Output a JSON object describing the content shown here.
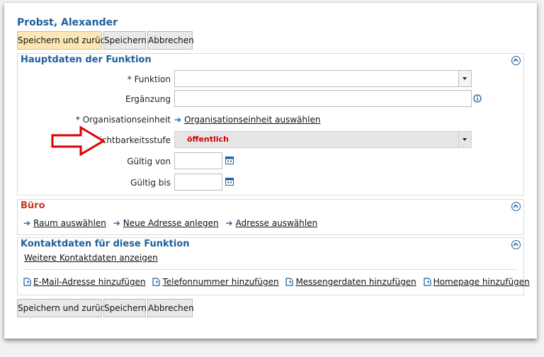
{
  "person": {
    "name": "Probst, Alexander"
  },
  "actions": {
    "save_back": "Speichern und zurück",
    "save": "Speichern",
    "cancel": "Abbrechen"
  },
  "main_section": {
    "title": "Hauptdaten der Funktion",
    "funktion_label": "* Funktion",
    "funktion_value": "",
    "ergaenzung_label": "Ergänzung",
    "ergaenzung_value": "",
    "orgeinheit_label": "* Organisationseinheit",
    "orgeinheit_link": "Organisationseinheit auswählen",
    "sichtbarkeit_label": "Sichtbarkeitsstufe",
    "sichtbarkeit_value": "öffentlich",
    "gueltig_von_label": "Gültig von",
    "gueltig_von_value": "",
    "gueltig_bis_label": "Gültig bis",
    "gueltig_bis_value": ""
  },
  "buero_section": {
    "title": "Büro",
    "links": [
      "Raum auswählen",
      "Neue Adresse anlegen",
      "Adresse auswählen"
    ]
  },
  "kontakt_section": {
    "title": "Kontaktdaten für diese Funktion",
    "more_link": "Weitere Kontaktdaten anzeigen",
    "add_links": [
      "E-Mail-Adresse hinzufügen",
      "Telefonnummer hinzufügen",
      "Messengerdaten hinzufügen",
      "Homepage hinzufügen"
    ]
  },
  "colors": {
    "heading": "#1f5f9c",
    "buero_title": "#c0392b",
    "value_red": "#d00000",
    "primary_button": "#fbe7b6",
    "annotation_arrow": "#e00000"
  },
  "icons": [
    "collapse-up-icon",
    "info-icon",
    "calendar-icon",
    "arrow-right-icon",
    "document-add-icon",
    "chevron-down-icon"
  ]
}
